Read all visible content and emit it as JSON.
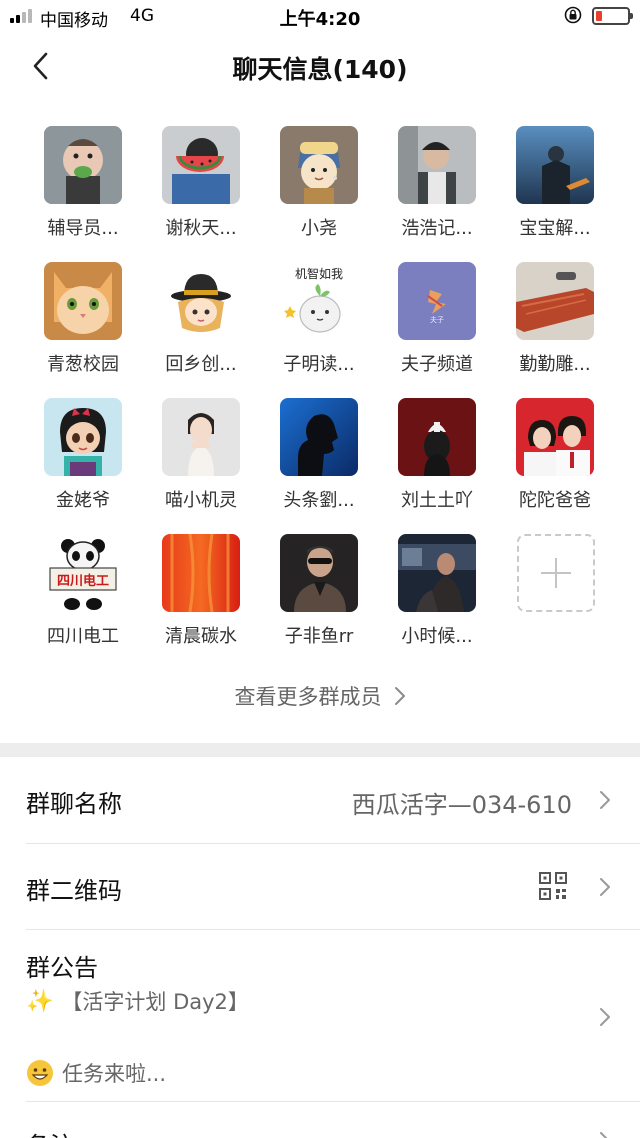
{
  "status_bar": {
    "carrier": "中国移动",
    "network": "4G",
    "time": "上午4:20",
    "battery_level": 0.2,
    "battery_color": "#e8402d"
  },
  "nav": {
    "back_icon": "chevron-left-icon",
    "title": "聊天信息(140)"
  },
  "members": [
    {
      "name": "辅导员..."
    },
    {
      "name": "谢秋天..."
    },
    {
      "name": "小尧"
    },
    {
      "name": "浩浩记..."
    },
    {
      "name": "宝宝解..."
    },
    {
      "name": "青葱校园"
    },
    {
      "name": "回乡创..."
    },
    {
      "name": "子明读..."
    },
    {
      "name": "夫子频道"
    },
    {
      "name": "勤勤雕..."
    },
    {
      "name": "金姥爷"
    },
    {
      "name": "喵小机灵"
    },
    {
      "name": "头条劉..."
    },
    {
      "name": "刘土土吖"
    },
    {
      "name": "陀陀爸爸"
    },
    {
      "name": "四川电工"
    },
    {
      "name": "清晨碳水"
    },
    {
      "name": "子非鱼rr"
    },
    {
      "name": "小时候..."
    }
  ],
  "avatar_texts": {
    "ziming": "机智如我",
    "fuzi": "夫子",
    "sichuan": "四川电工"
  },
  "add_member_icon": "plus-icon",
  "more_members_label": "查看更多群成员",
  "settings": {
    "group_name_label": "群聊名称",
    "group_name_value": "西瓜活字—034-610",
    "qr_label": "群二维码",
    "qr_icon": "qr-code-icon",
    "notice_label": "群公告",
    "notice_line1_emoji": "✨",
    "notice_line1": "【活字计划 Day2】",
    "notice_line2_emoji": "😄",
    "notice_line2": "任务来啦...",
    "remark_label": "备注"
  }
}
